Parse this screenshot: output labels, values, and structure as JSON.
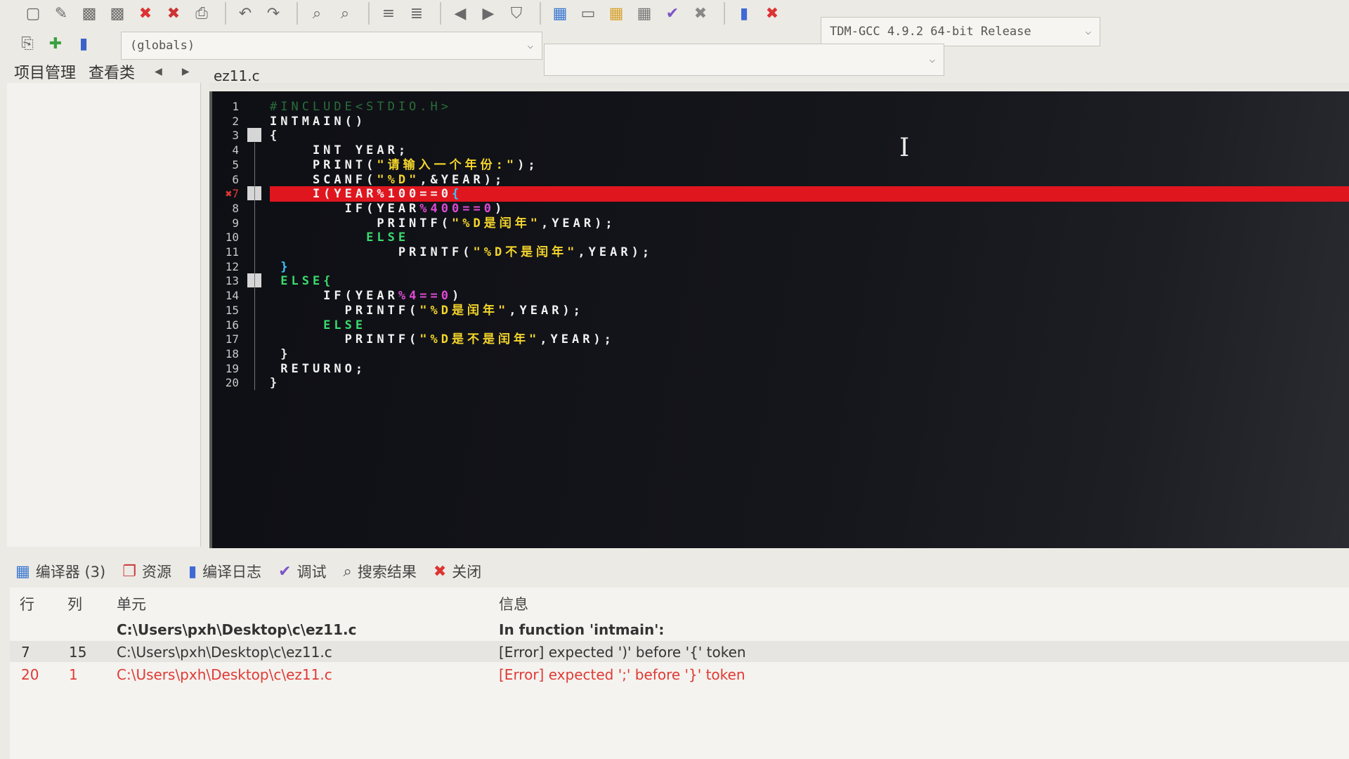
{
  "toolbar": {
    "compiler": "TDM-GCC 4.9.2 64-bit Release",
    "globals": "(globals)",
    "icons1": [
      "new-file-icon",
      "open-file-icon",
      "save-icon",
      "save-all-icon",
      "close-file-icon",
      "close-all-icon",
      "print-icon",
      "undo-icon",
      "redo-icon",
      "find-icon",
      "replace-icon",
      "indent-icon",
      "unindent-icon",
      "bookmark-prev-icon",
      "bookmark-next-icon",
      "toggle-bookmark-icon",
      "compile-icon",
      "run-icon",
      "compile-run-icon",
      "rebuild-icon",
      "check-syntax-icon",
      "stop-icon",
      "chart-icon",
      "profile-icon"
    ],
    "icons2": [
      "new-project-icon",
      "add-file-icon",
      "class-browser-icon"
    ]
  },
  "left_panel": {
    "tab_project": "项目管理",
    "tab_classes": "查看类"
  },
  "editor": {
    "file_tab": "ez11.c",
    "lines": [
      {
        "n": "1",
        "tokens": [
          [
            "pre",
            "#INCLUDE<STDIO.H>"
          ]
        ]
      },
      {
        "n": "2",
        "tokens": [
          [
            "def",
            "INTMAIN()"
          ]
        ]
      },
      {
        "n": "3",
        "tokens": [
          [
            "op",
            "{"
          ]
        ]
      },
      {
        "n": "4",
        "tokens": [
          [
            "def",
            "    INT YEAR;"
          ]
        ]
      },
      {
        "n": "5",
        "tokens": [
          [
            "def",
            "    PRINT("
          ],
          [
            "str",
            "\"请输入一个年份:\""
          ],
          [
            "def",
            ");"
          ]
        ]
      },
      {
        "n": "6",
        "tokens": [
          [
            "def",
            "    SCANF("
          ],
          [
            "str",
            "\"%D\""
          ],
          [
            "def",
            ",&YEAR);"
          ]
        ]
      },
      {
        "n": "7",
        "tokens": [
          [
            "def",
            "    I(YEAR%100==0"
          ],
          [
            "bracket",
            "{"
          ]
        ]
      },
      {
        "n": "8",
        "tokens": [
          [
            "def",
            "       IF(YEAR"
          ],
          [
            "num",
            "%400==0"
          ],
          [
            "def",
            ")"
          ]
        ]
      },
      {
        "n": "9",
        "tokens": [
          [
            "def",
            "          PRINTF("
          ],
          [
            "str",
            "\"%D是闰年\""
          ],
          [
            "def",
            ",YEAR);"
          ]
        ]
      },
      {
        "n": "10",
        "tokens": [
          [
            "kw",
            "         ELSE"
          ]
        ]
      },
      {
        "n": "11",
        "tokens": [
          [
            "def",
            "            PRINTF("
          ],
          [
            "str",
            "\"%D不是闰年\""
          ],
          [
            "def",
            ",YEAR);"
          ]
        ]
      },
      {
        "n": "12",
        "tokens": [
          [
            "bracket",
            " }"
          ]
        ]
      },
      {
        "n": "13",
        "tokens": [
          [
            "kw",
            " ELSE{"
          ]
        ]
      },
      {
        "n": "14",
        "tokens": [
          [
            "def",
            "     IF(YEAR"
          ],
          [
            "num",
            "%4==0"
          ],
          [
            "def",
            ")"
          ]
        ]
      },
      {
        "n": "15",
        "tokens": [
          [
            "def",
            "       PRINTF("
          ],
          [
            "str",
            "\"%D是闰年\""
          ],
          [
            "def",
            ",YEAR);"
          ]
        ]
      },
      {
        "n": "16",
        "tokens": [
          [
            "kw",
            "     ELSE"
          ]
        ]
      },
      {
        "n": "17",
        "tokens": [
          [
            "def",
            "       PRINTF("
          ],
          [
            "str",
            "\"%D是不是闰年\""
          ],
          [
            "def",
            ",YEAR);"
          ]
        ]
      },
      {
        "n": "18",
        "tokens": [
          [
            "op",
            " }"
          ]
        ]
      },
      {
        "n": "19",
        "tokens": [
          [
            "def",
            " RETURNO;"
          ]
        ]
      },
      {
        "n": "20",
        "tokens": [
          [
            "op",
            "}"
          ]
        ]
      }
    ],
    "error_line_marker": "✖7"
  },
  "bottom_tabs": [
    {
      "name": "tab-compiler",
      "icon": "compiler-icon",
      "glyph": "▦",
      "label": "编译器 (3)"
    },
    {
      "name": "tab-resources",
      "icon": "resources-icon",
      "glyph": "❐",
      "label": "资源"
    },
    {
      "name": "tab-compile-log",
      "icon": "chart-icon",
      "glyph": "▮",
      "label": "编译日志"
    },
    {
      "name": "tab-debug",
      "icon": "check-icon",
      "glyph": "✔",
      "label": "调试"
    },
    {
      "name": "tab-search-results",
      "icon": "search-icon",
      "glyph": "⌕",
      "label": "搜索结果"
    },
    {
      "name": "tab-close",
      "icon": "close-icon",
      "glyph": "✖",
      "label": "关闭"
    }
  ],
  "messages": {
    "headers": {
      "line": "行",
      "col": "列",
      "unit": "单元",
      "info": "信息"
    },
    "rows": [
      {
        "line": "",
        "col": "",
        "unit": "C:\\Users\\pxh\\Desktop\\c\\ez11.c",
        "info": "In function 'intmain':",
        "style": "bold"
      },
      {
        "line": "7",
        "col": "15",
        "unit": "C:\\Users\\pxh\\Desktop\\c\\ez11.c",
        "info": "[Error] expected ')' before '{' token",
        "style": "norm"
      },
      {
        "line": "20",
        "col": "1",
        "unit": "C:\\Users\\pxh\\Desktop\\c\\ez11.c",
        "info": "[Error] expected ';' before '}' token",
        "style": "err"
      }
    ]
  },
  "colors": {
    "error_highlight": "#e0161f",
    "editor_bg": "#0e0f14",
    "string": "#f4d52b",
    "keyword": "#3bdb6e",
    "number": "#e04ad8"
  }
}
